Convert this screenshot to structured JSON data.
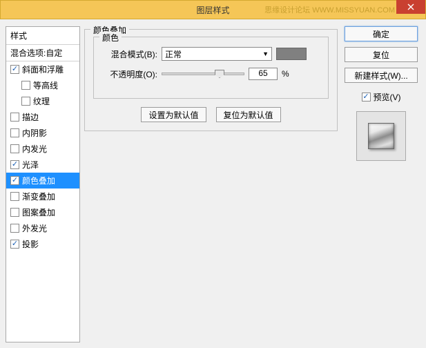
{
  "window": {
    "title": "图层样式",
    "watermark": "思缘设计论坛  WWW.MISSYUAN.COM"
  },
  "left": {
    "header": "样式",
    "sub": "混合选项:自定",
    "items": [
      {
        "label": "斜面和浮雕",
        "checked": true,
        "indent": false
      },
      {
        "label": "等高线",
        "checked": false,
        "indent": true
      },
      {
        "label": "纹理",
        "checked": false,
        "indent": true
      },
      {
        "label": "描边",
        "checked": false,
        "indent": false
      },
      {
        "label": "内阴影",
        "checked": false,
        "indent": false
      },
      {
        "label": "内发光",
        "checked": false,
        "indent": false
      },
      {
        "label": "光泽",
        "checked": true,
        "indent": false
      },
      {
        "label": "颜色叠加",
        "checked": true,
        "indent": false,
        "selected": true
      },
      {
        "label": "渐变叠加",
        "checked": false,
        "indent": false
      },
      {
        "label": "图案叠加",
        "checked": false,
        "indent": false
      },
      {
        "label": "外发光",
        "checked": false,
        "indent": false
      },
      {
        "label": "投影",
        "checked": true,
        "indent": false
      }
    ]
  },
  "mid": {
    "group_title": "颜色叠加",
    "inner_title": "颜色",
    "blend_label": "混合模式(B):",
    "blend_value": "正常",
    "opacity_label": "不透明度(O):",
    "opacity_value": "65",
    "opacity_unit": "%",
    "btn_default": "设置为默认值",
    "btn_reset": "复位为默认值",
    "swatch_color": "#808080"
  },
  "right": {
    "ok": "确定",
    "cancel": "复位",
    "new_style": "新建样式(W)...",
    "preview_label": "预览(V)",
    "preview_checked": true
  }
}
